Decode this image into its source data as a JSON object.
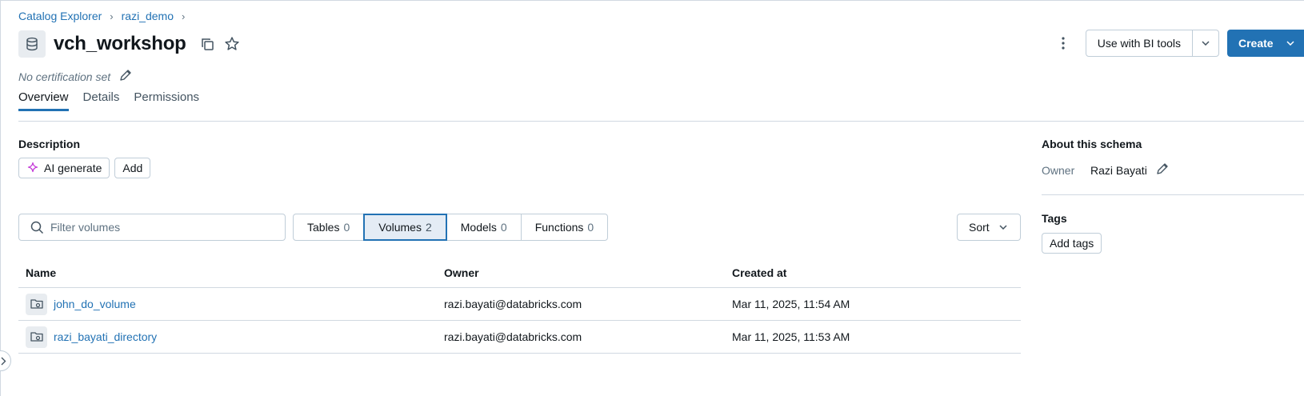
{
  "breadcrumb": {
    "root": "Catalog Explorer",
    "catalog": "razi_demo"
  },
  "header": {
    "title": "vch_workshop",
    "certification": "No certification set",
    "bi_tools_label": "Use with BI tools",
    "create_label": "Create"
  },
  "tabs": [
    {
      "label": "Overview",
      "active": true
    },
    {
      "label": "Details",
      "active": false
    },
    {
      "label": "Permissions",
      "active": false
    }
  ],
  "description": {
    "label": "Description",
    "ai_generate_label": "AI generate",
    "add_label": "Add"
  },
  "filter": {
    "placeholder": "Filter volumes"
  },
  "segments": [
    {
      "label": "Tables",
      "count": "0",
      "active": false
    },
    {
      "label": "Volumes",
      "count": "2",
      "active": true
    },
    {
      "label": "Models",
      "count": "0",
      "active": false
    },
    {
      "label": "Functions",
      "count": "0",
      "active": false
    }
  ],
  "sort_label": "Sort",
  "table": {
    "columns": [
      "Name",
      "Owner",
      "Created at"
    ],
    "rows": [
      {
        "name": "john_do_volume",
        "owner": "razi.bayati@databricks.com",
        "created": "Mar 11, 2025, 11:54 AM"
      },
      {
        "name": "razi_bayati_directory",
        "owner": "razi.bayati@databricks.com",
        "created": "Mar 11, 2025, 11:53 AM"
      }
    ]
  },
  "about": {
    "title": "About this schema",
    "owner_key": "Owner",
    "owner_value": "Razi Bayati",
    "tags_label": "Tags",
    "add_tags_label": "Add tags"
  },
  "colors": {
    "accent": "#2272b4",
    "border": "#c0cdd8",
    "muted_text": "#5f7281",
    "ai_icon": "#c63fd9"
  },
  "icons": [
    "schema-database-icon",
    "copy-icon",
    "star-icon",
    "pencil-icon",
    "kebab-menu-icon",
    "chevron-down-icon",
    "sparkle-icon",
    "search-icon",
    "volume-folder-icon",
    "chevron-right-icon"
  ]
}
